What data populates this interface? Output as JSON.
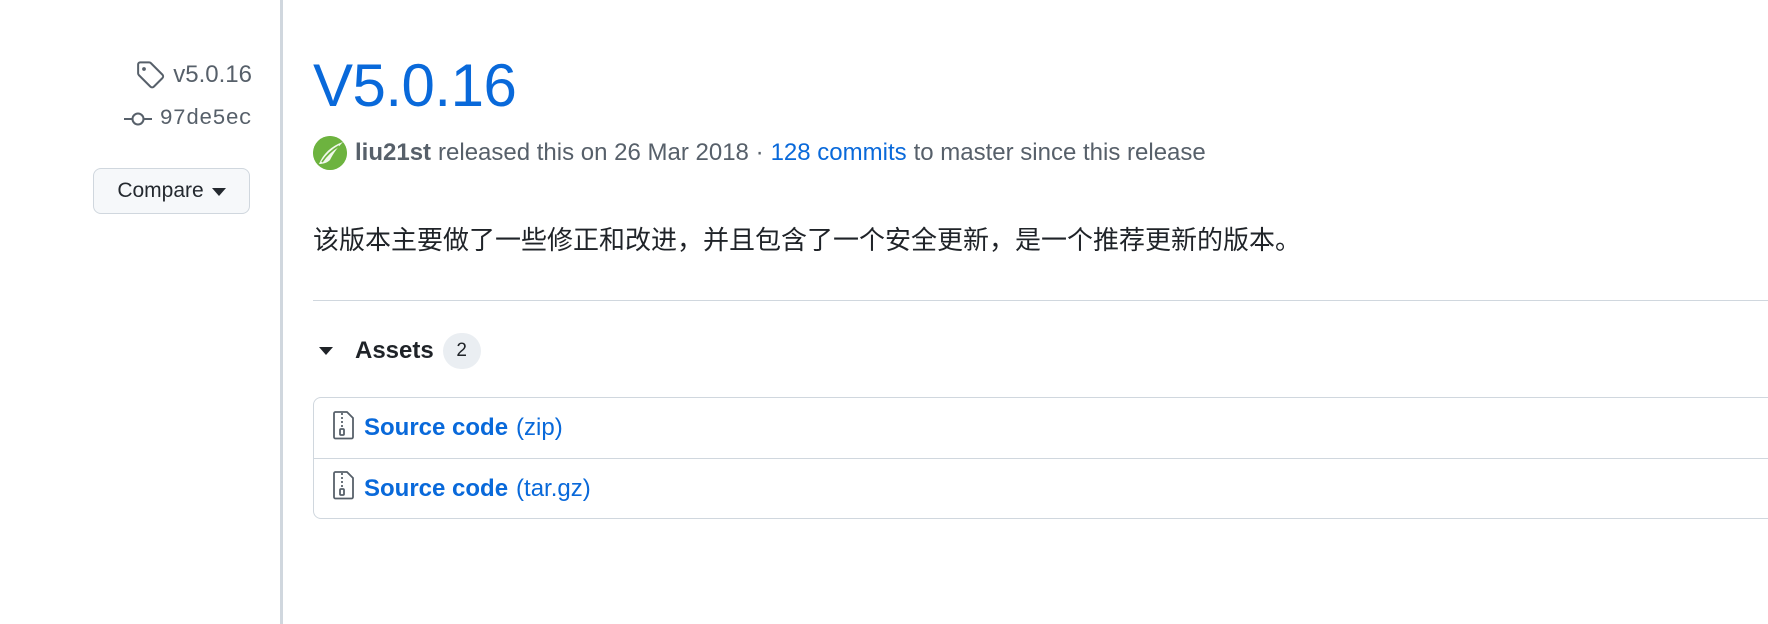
{
  "sidebar": {
    "tag": "v5.0.16",
    "commit": "97de5ec",
    "compare_label": "Compare"
  },
  "release": {
    "title": "V5.0.16",
    "author": "liu21st",
    "released_text": "released this on 26 Mar 2018 ·",
    "commits_link": "128 commits",
    "commits_suffix": "to master since this release",
    "body": "该版本主要做了一些修正和改进，并且包含了一个安全更新，是一个推荐更新的版本。"
  },
  "assets": {
    "label": "Assets",
    "count": "2",
    "items": [
      {
        "name": "Source code",
        "ext": "(zip)"
      },
      {
        "name": "Source code",
        "ext": "(tar.gz)"
      }
    ]
  },
  "colors": {
    "link": "#0969da",
    "muted": "#57606a",
    "border": "#d0d7de",
    "avatar": "#6db33f"
  }
}
